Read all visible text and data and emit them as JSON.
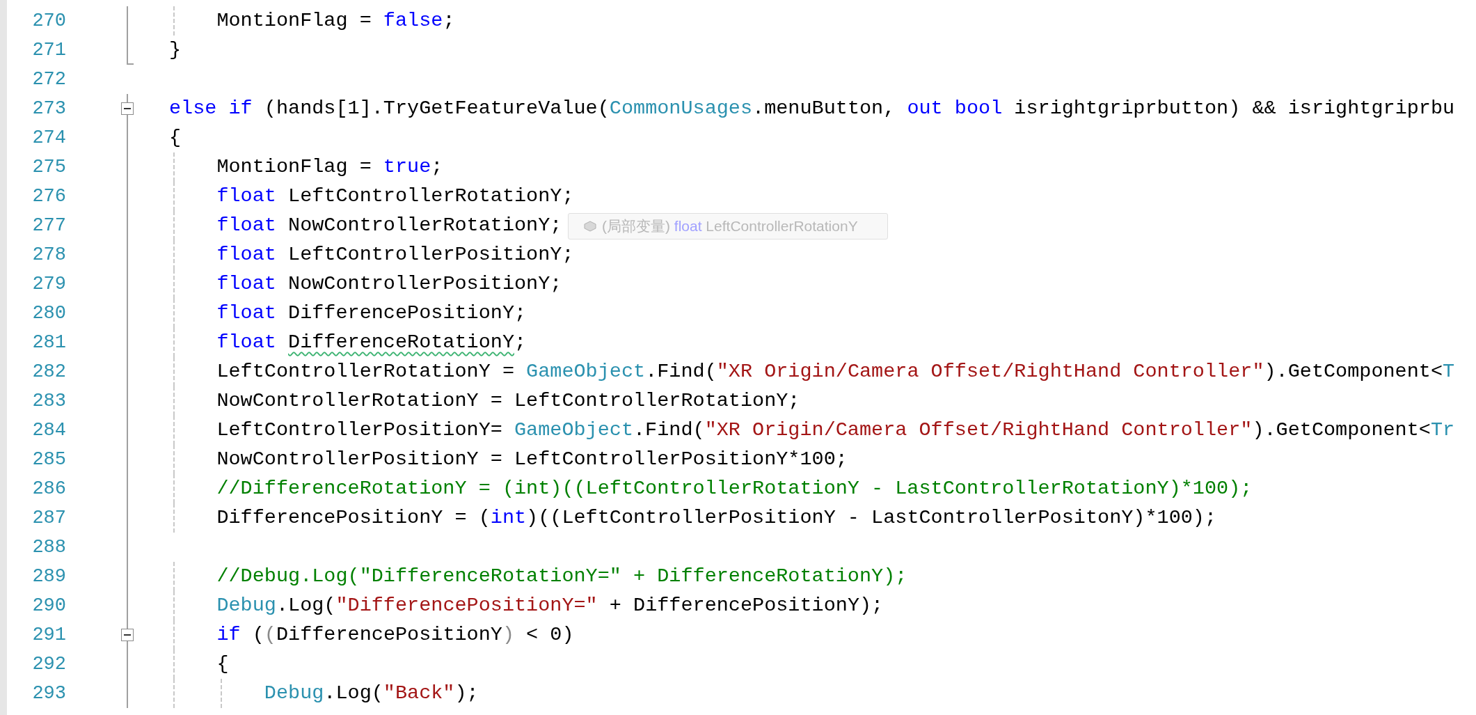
{
  "editor": {
    "lines": [
      {
        "number": "270",
        "in_block": true,
        "block_start": false,
        "block_end": false,
        "tokens": [
          {
            "kind": "plain",
            "text": "    MontionFlag = "
          },
          {
            "kind": "keyword",
            "text": "false"
          },
          {
            "kind": "plain",
            "text": ";"
          }
        ]
      },
      {
        "number": "271",
        "in_block": true,
        "block_start": false,
        "block_end": true,
        "tokens": [
          {
            "kind": "plain",
            "text": "}"
          }
        ]
      },
      {
        "number": "272",
        "in_block": false,
        "block_start": false,
        "block_end": false
      },
      {
        "number": "273",
        "in_block": true,
        "block_start": true,
        "block_end": false,
        "tokens": [
          {
            "kind": "keyword",
            "text": "else if"
          },
          {
            "kind": "plain",
            "text": " (hands[1].TryGetFeatureValue("
          },
          {
            "kind": "type",
            "text": "CommonUsages"
          },
          {
            "kind": "plain",
            "text": ".menuButton, "
          },
          {
            "kind": "keyword",
            "text": "out bool"
          },
          {
            "kind": "plain",
            "text": " isrightgriprbutton) && isrightgriprbu"
          }
        ]
      },
      {
        "number": "274",
        "in_block": true,
        "block_start": false,
        "block_end": false,
        "tokens": [
          {
            "kind": "plain",
            "text": "{"
          }
        ]
      },
      {
        "number": "275",
        "in_block": true,
        "block_start": false,
        "block_end": false,
        "tokens": [
          {
            "kind": "plain",
            "text": "    MontionFlag = "
          },
          {
            "kind": "keyword",
            "text": "true"
          },
          {
            "kind": "plain",
            "text": ";"
          }
        ]
      },
      {
        "number": "276",
        "in_block": true,
        "block_start": false,
        "block_end": false,
        "tokens": [
          {
            "kind": "keyword",
            "text": "    float"
          },
          {
            "kind": "plain",
            "text": " LeftControllerRotationY;"
          }
        ]
      },
      {
        "number": "277",
        "in_block": true,
        "block_start": false,
        "block_end": false,
        "tokens": [
          {
            "kind": "keyword",
            "text": "    float"
          },
          {
            "kind": "plain",
            "text": " NowControllerRotationY;"
          }
        ]
      },
      {
        "number": "278",
        "in_block": true,
        "block_start": false,
        "block_end": false,
        "tokens": [
          {
            "kind": "keyword",
            "text": "    float"
          },
          {
            "kind": "plain",
            "text": " LeftControllerPositionY;"
          }
        ]
      },
      {
        "number": "279",
        "in_block": true,
        "block_start": false,
        "block_end": false,
        "tokens": [
          {
            "kind": "keyword",
            "text": "    float"
          },
          {
            "kind": "plain",
            "text": " NowControllerPositionY;"
          }
        ]
      },
      {
        "number": "280",
        "in_block": true,
        "block_start": false,
        "block_end": false,
        "tokens": [
          {
            "kind": "keyword",
            "text": "    float"
          },
          {
            "kind": "plain",
            "text": " DifferencePositionY;"
          }
        ]
      },
      {
        "number": "281",
        "in_block": true,
        "block_start": false,
        "block_end": false,
        "tokens": [
          {
            "kind": "keyword",
            "text": "    float "
          },
          {
            "kind": "plain",
            "text": "DifferenceRotationY",
            "squiggle": true
          },
          {
            "kind": "plain",
            "text": ";"
          }
        ]
      },
      {
        "number": "282",
        "in_block": true,
        "block_start": false,
        "block_end": false,
        "tokens": [
          {
            "kind": "plain",
            "text": "    LeftControllerRotationY = "
          },
          {
            "kind": "type",
            "text": "GameObject"
          },
          {
            "kind": "plain",
            "text": ".Find("
          },
          {
            "kind": "string",
            "text": "\"XR Origin/Camera Offset/RightHand Controller\""
          },
          {
            "kind": "plain",
            "text": ").GetComponent<"
          },
          {
            "kind": "type",
            "text": "T"
          }
        ]
      },
      {
        "number": "283",
        "in_block": true,
        "block_start": false,
        "block_end": false,
        "tokens": [
          {
            "kind": "plain",
            "text": "    NowControllerRotationY = LeftControllerRotationY;"
          }
        ]
      },
      {
        "number": "284",
        "in_block": true,
        "block_start": false,
        "block_end": false,
        "tokens": [
          {
            "kind": "plain",
            "text": "    LeftControllerPositionY= "
          },
          {
            "kind": "type",
            "text": "GameObject"
          },
          {
            "kind": "plain",
            "text": ".Find("
          },
          {
            "kind": "string",
            "text": "\"XR Origin/Camera Offset/RightHand Controller\""
          },
          {
            "kind": "plain",
            "text": ").GetComponent<"
          },
          {
            "kind": "type",
            "text": "Tr"
          }
        ]
      },
      {
        "number": "285",
        "in_block": true,
        "block_start": false,
        "block_end": false,
        "tokens": [
          {
            "kind": "plain",
            "text": "    NowControllerPositionY = LeftControllerPositionY*100;"
          }
        ]
      },
      {
        "number": "286",
        "in_block": true,
        "block_start": false,
        "block_end": false,
        "tokens": [
          {
            "kind": "comment",
            "text": "    //DifferenceRotationY = (int)((LeftControllerRotationY - LastControllerRotationY)*100);"
          }
        ]
      },
      {
        "number": "287",
        "in_block": true,
        "block_start": false,
        "block_end": false,
        "tokens": [
          {
            "kind": "plain",
            "text": "    DifferencePositionY = ("
          },
          {
            "kind": "keyword",
            "text": "int"
          },
          {
            "kind": "plain",
            "text": ")((LeftControllerPositionY - LastControllerPositonY)*100);"
          }
        ]
      },
      {
        "number": "288",
        "in_block": true,
        "block_start": false,
        "block_end": false
      },
      {
        "number": "289",
        "in_block": true,
        "block_start": false,
        "block_end": false,
        "tokens": [
          {
            "kind": "comment",
            "text": "    //Debug.Log(\"DifferenceRotationY=\" + DifferenceRotationY);"
          }
        ]
      },
      {
        "number": "290",
        "in_block": true,
        "block_start": false,
        "block_end": false,
        "tokens": [
          {
            "kind": "type",
            "text": "    Debug"
          },
          {
            "kind": "plain",
            "text": ".Log("
          },
          {
            "kind": "string",
            "text": "\"DifferencePositionY=\""
          },
          {
            "kind": "plain",
            "text": " + DifferencePositionY);"
          }
        ]
      },
      {
        "number": "291",
        "in_block": true,
        "block_start": true,
        "block_end": false,
        "tokens": [
          {
            "kind": "keyword",
            "text": "    if"
          },
          {
            "kind": "plain",
            "text": " ("
          },
          {
            "kind": "dim",
            "text": "("
          },
          {
            "kind": "plain",
            "text": "DifferencePositionY"
          },
          {
            "kind": "dim",
            "text": ")"
          },
          {
            "kind": "plain",
            "text": " < 0)"
          }
        ]
      },
      {
        "number": "292",
        "in_block": true,
        "block_start": false,
        "block_end": false,
        "tokens": [
          {
            "kind": "plain",
            "text": "    {"
          }
        ]
      },
      {
        "number": "293",
        "in_block": true,
        "block_start": false,
        "block_end": false,
        "tokens": [
          {
            "kind": "type",
            "text": "        Debug"
          },
          {
            "kind": "plain",
            "text": ".Log("
          },
          {
            "kind": "string",
            "text": "\"Back\""
          },
          {
            "kind": "plain",
            "text": ");"
          }
        ]
      }
    ]
  },
  "quick_info": {
    "scope": "(局部变量)",
    "type_keyword": "float",
    "name": "LeftControllerRotationY"
  }
}
